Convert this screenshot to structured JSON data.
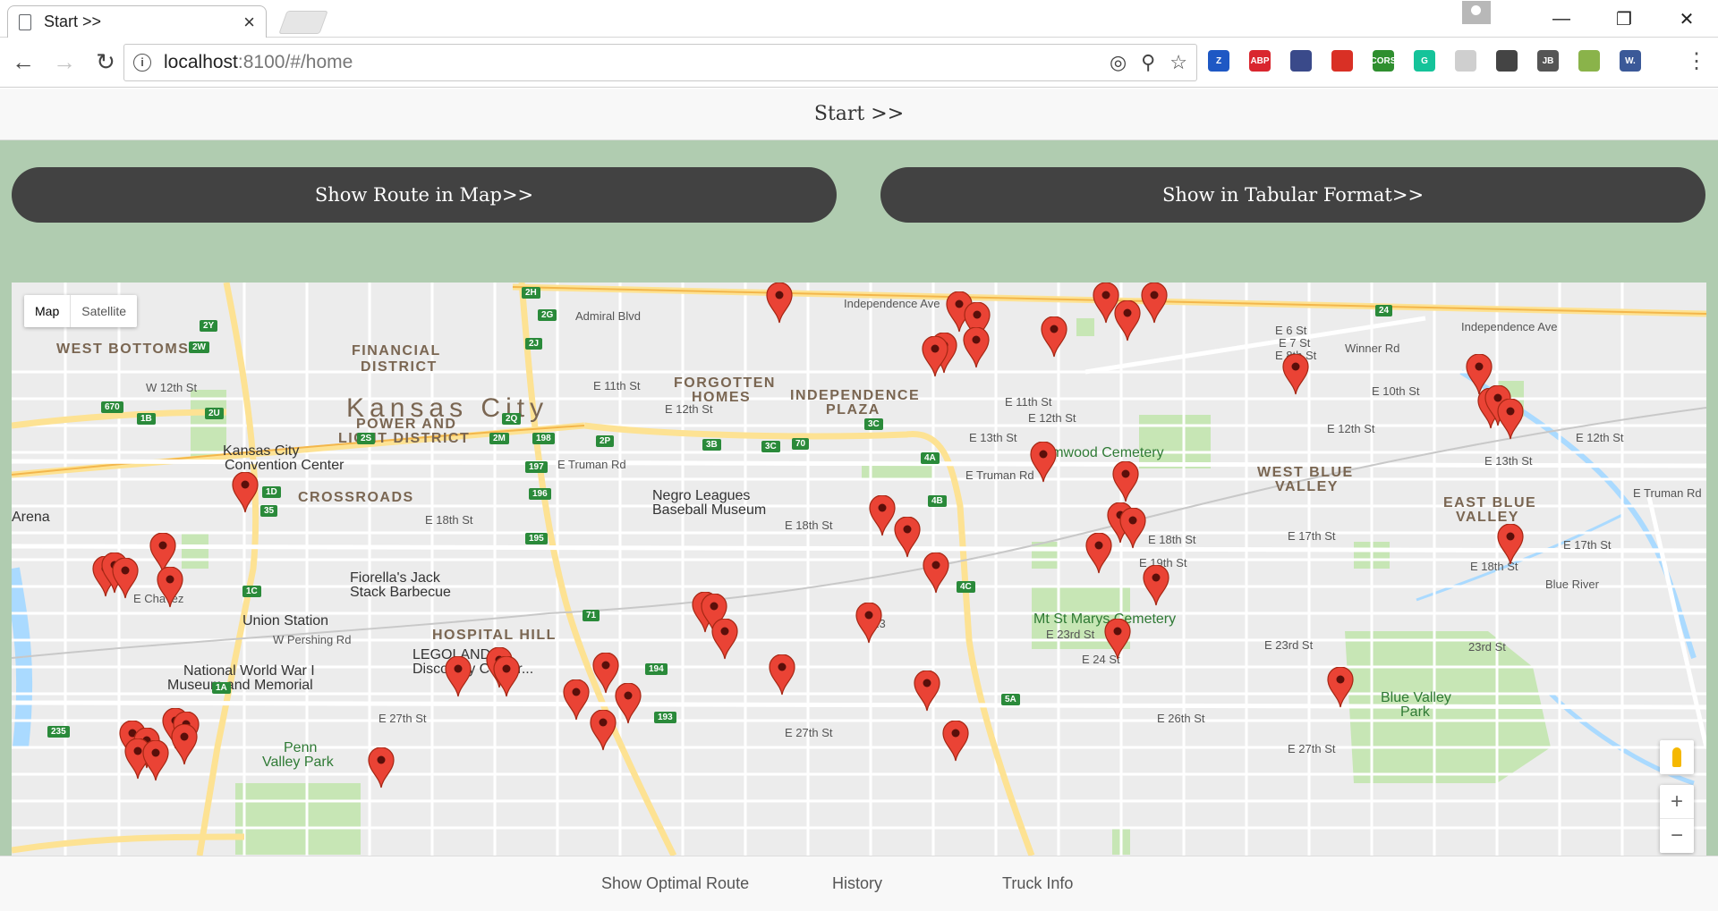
{
  "browser": {
    "tab_title": "Start >>",
    "url_host": "localhost",
    "url_rest": ":8100/#/home",
    "extensions": [
      {
        "icon": "z-extension-icon",
        "text": "Z",
        "color": "#1e58c4"
      },
      {
        "icon": "adblock-icon",
        "text": "ABP",
        "color": "#d9262e"
      },
      {
        "icon": "extension-icon",
        "text": "",
        "color": "#3a4a8a"
      },
      {
        "icon": "bookmark-extension-icon",
        "text": "",
        "color": "#d93025"
      },
      {
        "icon": "cors-icon",
        "text": "CORS",
        "color": "#2f8f2f"
      },
      {
        "icon": "grammarly-icon",
        "text": "G",
        "color": "#15c39a"
      },
      {
        "icon": "extension-icon",
        "text": "",
        "color": "#cfcfcf"
      },
      {
        "icon": "shield-icon",
        "text": "",
        "color": "#444444"
      },
      {
        "icon": "jb-icon",
        "text": "JB",
        "color": "#555555"
      },
      {
        "icon": "face-icon",
        "text": "",
        "color": "#8ab34a"
      },
      {
        "icon": "w-extension-icon",
        "text": "W.",
        "color": "#3b5998"
      }
    ]
  },
  "header": {
    "title": "Start >>"
  },
  "buttons": {
    "show_route": "Show Route in Map>>",
    "show_table": "Show in Tabular Format>>"
  },
  "map": {
    "type_map": "Map",
    "type_satellite": "Satellite",
    "zoom_in": "+",
    "zoom_out": "−",
    "labels": {
      "city": "Kansas City",
      "west_bottoms": "WEST BOTTOMS",
      "financial_district_1": "FINANCIAL",
      "financial_district_2": "DISTRICT",
      "power_light_1": "POWER AND",
      "power_light_2": "LIGHT DISTRICT",
      "forgotten_homes_1": "FORGOTTEN",
      "forgotten_homes_2": "HOMES",
      "independence_plaza_1": "INDEPENDENCE",
      "independence_plaza_2": "PLAZA",
      "crossroads": "CROSSROADS",
      "hospital_hill": "HOSPITAL HILL",
      "west_blue_valley_1": "WEST BLUE",
      "west_blue_valley_2": "VALLEY",
      "east_blue_valley_1": "EAST BLUE",
      "east_blue_valley_2": "VALLEY",
      "convention_center_1": "Kansas City",
      "convention_center_2": "Convention Center",
      "negro_leagues_1": "Negro Leagues",
      "negro_leagues_2": "Baseball Museum",
      "fiorella_1": "Fiorella's Jack",
      "fiorella_2": "Stack Barbecue",
      "union_station": "Union Station",
      "legoland_1": "LEGOLAND at",
      "legoland_2": "Discovery Center...",
      "wwi_1": "National World War I",
      "wwi_2": "Museum and Memorial",
      "elmwood_cemetery": "Elmwood Cemetery",
      "mt_st_marys": "Mt St Marys Cemetery",
      "blue_valley_park_1": "Blue Valley",
      "blue_valley_park_2": "Park",
      "penn_valley_1": "Penn",
      "penn_valley_2": "Valley Park",
      "arena": "Arena",
      "independence_ave_1": "Independence Ave",
      "independence_ave_2": "Independence Ave",
      "admiral_blvd": "Admiral Blvd",
      "e_12th_st_1": "E 12th St",
      "w_12th_st": "W 12th St",
      "e_11th_st": "E 11th St",
      "e_truman_rd": "E Truman Rd",
      "e_18th_st": "E 18th St",
      "e_17th_st": "E 17th St",
      "e_23rd_st": "E 23rd St",
      "e_27th_st": "E 27th St",
      "e_13th_st": "E 13th St",
      "e_10th_st": "E 10th St",
      "blue_river": "Blue River",
      "winner_rd": "Winner Rd",
      "w_pershing_rd": "W Pershing Rd",
      "e_26th_st": "E 26th St",
      "23rd_st": "23rd St",
      "e_18th_st_2": "E 18th St",
      "e_19th_st": "E 19th St",
      "e_truman_rd_2": "E Truman Rd",
      "e_12th_st_2": "E 12th St",
      "e_12th_st_3": "E 12th St",
      "e_13th_st_2": "E 13th St",
      "e_12th_st_4": "E 12th St",
      "e_6_st": "E 6 St",
      "e_7_st": "E 7 St",
      "e_8th_st": "E 8th St",
      "e_18th_st_3": "E 18th St",
      "e_24_st": "E 24 St",
      "e_23rd_st_2": "E 23rd St",
      "e_27th_st_2": "E 27th St",
      "e_23": "E 23",
      "e_27th_st_3": "E 27th St",
      "e_chavez": "E Chavez",
      "e_18th_st_4": "E 18th St",
      "e_truman_rd_3": "E Truman Rd",
      "e_17th_st_2": "E 17th St",
      "e_11th_st_2": "E 11th St"
    },
    "shields": [
      "2Y",
      "2W",
      "1B",
      "2U",
      "2S",
      "2M",
      "2Q",
      "198",
      "2P",
      "3B",
      "3C",
      "3C",
      "4A",
      "4B",
      "4C",
      "5A",
      "2H",
      "2G",
      "2J",
      "197",
      "196",
      "195",
      "194",
      "193",
      "1D",
      "1C",
      "1A",
      "670",
      "35",
      "71",
      "70",
      "24",
      "235"
    ]
  },
  "bottom_nav": {
    "optimal_route": "Show Optimal Route",
    "history": "History",
    "truck_info": "Truck Info"
  }
}
